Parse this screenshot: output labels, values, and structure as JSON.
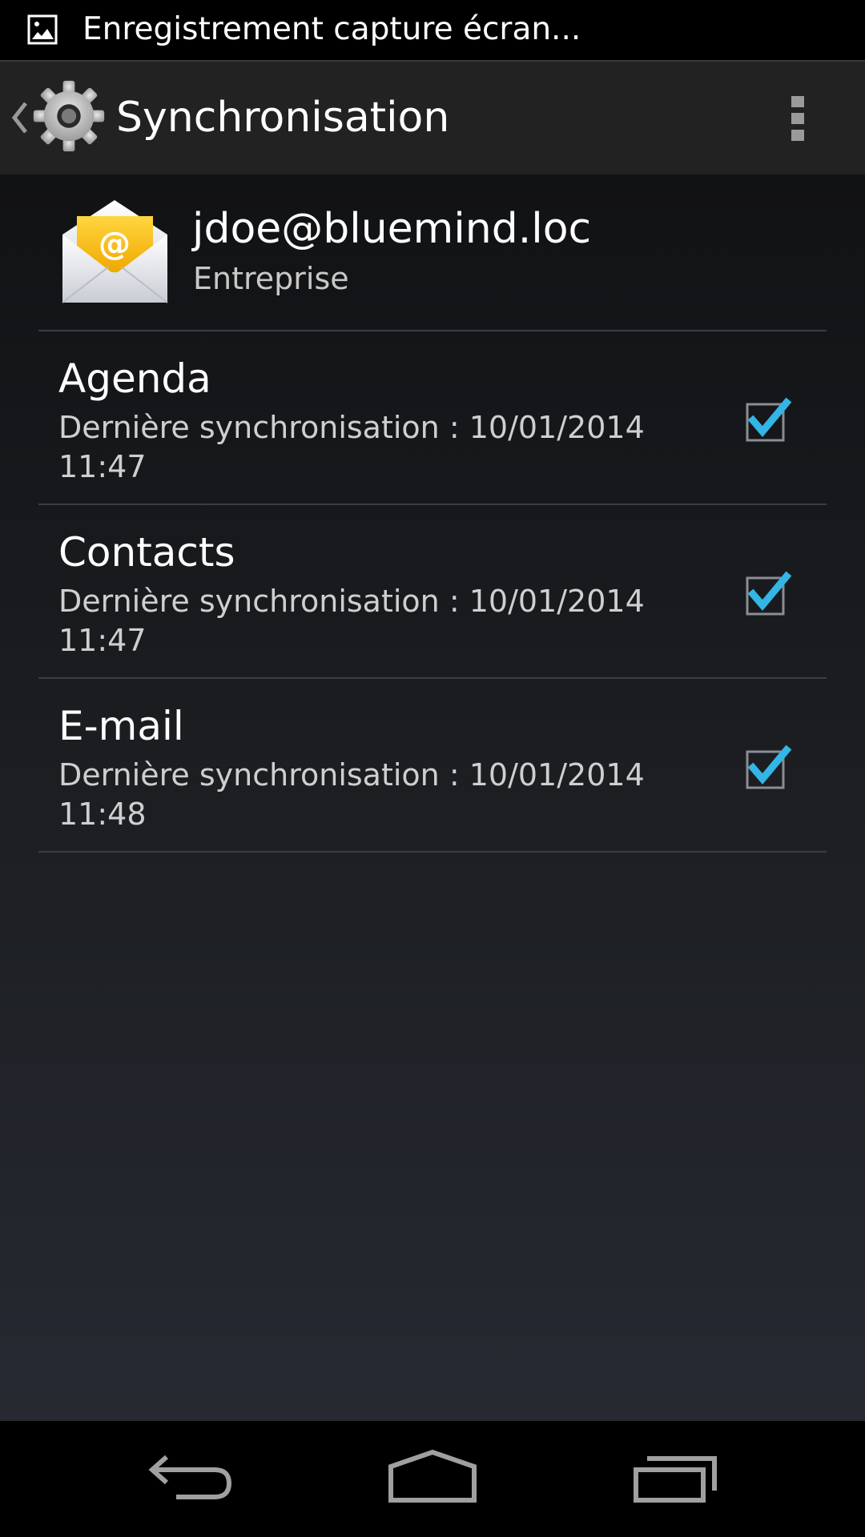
{
  "status_bar": {
    "notification_text": "Enregistrement capture écran...",
    "icon": "image-icon"
  },
  "action_bar": {
    "title": "Synchronisation",
    "app_icon": "gear-icon",
    "up_icon": "up-caret-icon",
    "overflow_icon": "overflow-menu-icon"
  },
  "account": {
    "email": "jdoe@bluemind.loc",
    "type": "Entreprise",
    "icon": "email-envelope-icon"
  },
  "sync_items": [
    {
      "title": "Agenda",
      "summary": "Dernière synchronisation : 10/01/2014 11:47",
      "checked": true
    },
    {
      "title": "Contacts",
      "summary": "Dernière synchronisation : 10/01/2014 11:47",
      "checked": true
    },
    {
      "title": "E-mail",
      "summary": "Dernière synchronisation : 10/01/2014 11:48",
      "checked": true
    }
  ],
  "nav_bar": {
    "back_icon": "back-icon",
    "home_icon": "home-icon",
    "recents_icon": "recents-icon"
  },
  "colors": {
    "accent": "#33b5e5",
    "action_bar": "#222222",
    "divider": "#3b3d42"
  }
}
